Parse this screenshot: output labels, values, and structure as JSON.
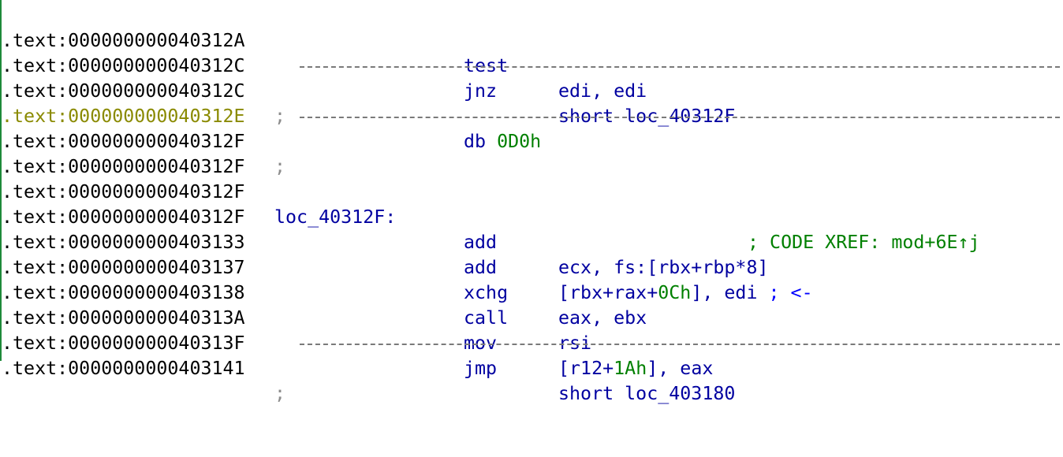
{
  "colors": {
    "address": "#000000",
    "address_highlight": "#8a8a00",
    "instruction": "#0000a0",
    "immediate": "#008000",
    "comment": "#0000ff",
    "xref": "#008000",
    "separator": "#8c8c8c"
  },
  "lines": [
    {
      "address": ".text:000000000040312A",
      "mnemonic": "test",
      "operands": "edi, edi"
    },
    {
      "address": ".text:000000000040312C",
      "mnemonic": "jnz",
      "operands": "short loc_40312F"
    },
    {
      "address": ".text:000000000040312C",
      "separator": ";"
    },
    {
      "address": ".text:000000000040312E",
      "mnemonic": "db",
      "operand_num": "0D0h"
    },
    {
      "address": ".text:000000000040312F",
      "separator": ";"
    },
    {
      "address": ".text:000000000040312F"
    },
    {
      "address": ".text:000000000040312F",
      "label": "loc_40312F:",
      "xref": "; CODE XREF: mod+6E↑j"
    },
    {
      "address": ".text:000000000040312F",
      "mnemonic": "add",
      "operands": "ecx, fs:[rbx+rbp*8]"
    },
    {
      "address": ".text:0000000000403133",
      "mnemonic": "add",
      "operands_pre": "[rbx+rax+",
      "operand_num": "0Ch",
      "operands_post": "], edi",
      "comment": "; <-"
    },
    {
      "address": ".text:0000000000403137",
      "mnemonic": "xchg",
      "operands": "eax, ebx"
    },
    {
      "address": ".text:0000000000403138",
      "mnemonic": "call",
      "operands": "rsi"
    },
    {
      "address": ".text:000000000040313A",
      "mnemonic": "mov",
      "operands_pre": "[r12+",
      "operand_num": "1Ah",
      "operands_post": "], eax"
    },
    {
      "address": ".text:000000000040313F",
      "mnemonic": "jmp",
      "operands": "short loc_403180"
    },
    {
      "address": ".text:0000000000403141",
      "separator": ";"
    }
  ]
}
